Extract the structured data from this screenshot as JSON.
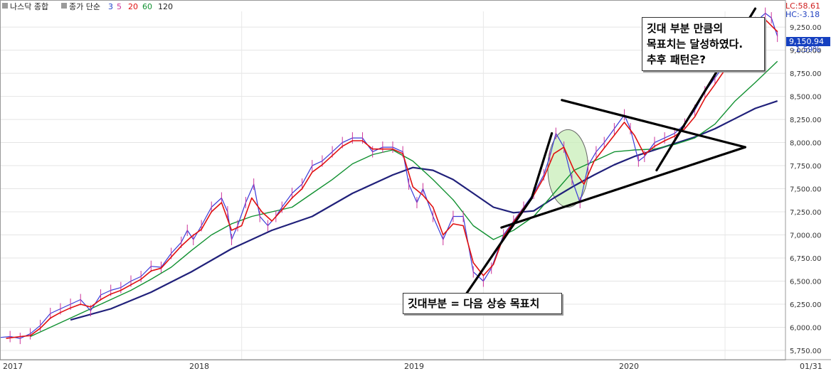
{
  "legend": {
    "title": "나스닥 종합",
    "series_label": "종가 단순",
    "periods": [
      "3",
      "5",
      "20",
      "60",
      "120"
    ]
  },
  "price_tag": "9,150.94",
  "info_lines": [
    "LC:58.61",
    "HC:-3.18",
    "-1.59%"
  ],
  "annotations": {
    "top": [
      "깃대 부분 만큼의",
      "목표치는 달성하였다.",
      "추후 패턴은?"
    ],
    "bottom": "깃대부분 = 다음 상승 목표치"
  },
  "chart_data": {
    "type": "line",
    "title": "나스닥 종합",
    "x_ticks": [
      "2017",
      "2018",
      "2019",
      "2020",
      "01/31"
    ],
    "y_ticks": [
      "9,250.00",
      "9,000.00",
      "8,750.00",
      "8,500.00",
      "8,250.00",
      "8,000.00",
      "7,750.00",
      "7,500.00",
      "7,250.00",
      "7,000.00",
      "6,750.00",
      "6,500.00",
      "6,250.00",
      "6,000.00",
      "5,750.00"
    ],
    "ylim": [
      5650,
      9420
    ],
    "xlim": [
      0,
      37
    ],
    "colors": {
      "price": "#3b3bd8",
      "price_alt": "#cc3399",
      "ma20": "#e01010",
      "ma60": "#109030",
      "ma120": "#20207a",
      "trend": "#000000",
      "highlight": "#c8eeb8",
      "price_tag_bg": "#1540c0",
      "info": "#d02020",
      "info2": "#2040c0"
    },
    "series": [
      {
        "name": "종가 단순 3",
        "values": [
          [
            0,
            5890
          ],
          [
            0.5,
            5900
          ],
          [
            1,
            5880
          ],
          [
            1.5,
            5930
          ],
          [
            2,
            6020
          ],
          [
            2.5,
            6150
          ],
          [
            3,
            6200
          ],
          [
            3.5,
            6250
          ],
          [
            4,
            6300
          ],
          [
            4.5,
            6180
          ],
          [
            5,
            6350
          ],
          [
            5.5,
            6400
          ],
          [
            6,
            6430
          ],
          [
            6.5,
            6500
          ],
          [
            7,
            6550
          ],
          [
            7.5,
            6660
          ],
          [
            8,
            6650
          ],
          [
            8.5,
            6800
          ],
          [
            9,
            6920
          ],
          [
            9.3,
            7050
          ],
          [
            9.6,
            6950
          ],
          [
            10,
            7100
          ],
          [
            10.5,
            7300
          ],
          [
            11,
            7400
          ],
          [
            11.3,
            7250
          ],
          [
            11.5,
            6950
          ],
          [
            11.8,
            7100
          ],
          [
            12.2,
            7350
          ],
          [
            12.6,
            7550
          ],
          [
            12.9,
            7200
          ],
          [
            13.3,
            7100
          ],
          [
            13.7,
            7200
          ],
          [
            14,
            7300
          ],
          [
            14.5,
            7450
          ],
          [
            15,
            7550
          ],
          [
            15.5,
            7750
          ],
          [
            16,
            7800
          ],
          [
            16.5,
            7900
          ],
          [
            17,
            8000
          ],
          [
            17.5,
            8050
          ],
          [
            18,
            8050
          ],
          [
            18.5,
            7900
          ],
          [
            19,
            7950
          ],
          [
            19.5,
            7950
          ],
          [
            20,
            7900
          ],
          [
            20.3,
            7550
          ],
          [
            20.7,
            7350
          ],
          [
            21,
            7500
          ],
          [
            21.5,
            7200
          ],
          [
            22,
            6950
          ],
          [
            22.5,
            7200
          ],
          [
            23,
            7200
          ],
          [
            23.5,
            6600
          ],
          [
            24,
            6500
          ],
          [
            24.4,
            6640
          ],
          [
            25,
            7000
          ],
          [
            25.5,
            7150
          ],
          [
            26,
            7300
          ],
          [
            26.5,
            7450
          ],
          [
            27,
            7650
          ],
          [
            27.3,
            7850
          ],
          [
            27.6,
            8100
          ],
          [
            28,
            7950
          ],
          [
            28.4,
            7600
          ],
          [
            28.8,
            7350
          ],
          [
            29.2,
            7750
          ],
          [
            29.6,
            7900
          ],
          [
            30,
            8000
          ],
          [
            30.5,
            8150
          ],
          [
            31,
            8300
          ],
          [
            31.3,
            8150
          ],
          [
            31.7,
            7800
          ],
          [
            32,
            7850
          ],
          [
            32.5,
            8000
          ],
          [
            33,
            8050
          ],
          [
            33.5,
            8100
          ],
          [
            34,
            8200
          ],
          [
            34.5,
            8350
          ],
          [
            35,
            8550
          ],
          [
            35.5,
            8700
          ],
          [
            36,
            8850
          ],
          [
            36.5,
            9000
          ],
          [
            37,
            9150
          ],
          [
            37.5,
            9300
          ],
          [
            38,
            9400
          ],
          [
            38.3,
            9350
          ],
          [
            38.6,
            9150
          ]
        ]
      },
      {
        "name": "20",
        "values": [
          [
            0.3,
            5880
          ],
          [
            1,
            5900
          ],
          [
            1.5,
            5910
          ],
          [
            2,
            5990
          ],
          [
            2.5,
            6100
          ],
          [
            3,
            6160
          ],
          [
            3.5,
            6210
          ],
          [
            4,
            6250
          ],
          [
            4.5,
            6220
          ],
          [
            5,
            6300
          ],
          [
            5.5,
            6360
          ],
          [
            6,
            6400
          ],
          [
            6.5,
            6460
          ],
          [
            7,
            6520
          ],
          [
            7.5,
            6610
          ],
          [
            8,
            6640
          ],
          [
            8.5,
            6760
          ],
          [
            9,
            6880
          ],
          [
            9.5,
            6980
          ],
          [
            10,
            7060
          ],
          [
            10.5,
            7250
          ],
          [
            11,
            7350
          ],
          [
            11.5,
            7050
          ],
          [
            12,
            7100
          ],
          [
            12.5,
            7400
          ],
          [
            13,
            7250
          ],
          [
            13.5,
            7150
          ],
          [
            14,
            7270
          ],
          [
            14.5,
            7400
          ],
          [
            15,
            7500
          ],
          [
            15.5,
            7680
          ],
          [
            16,
            7760
          ],
          [
            16.5,
            7860
          ],
          [
            17,
            7960
          ],
          [
            17.5,
            8020
          ],
          [
            18,
            8020
          ],
          [
            18.5,
            7930
          ],
          [
            19,
            7930
          ],
          [
            19.5,
            7930
          ],
          [
            20,
            7880
          ],
          [
            20.5,
            7520
          ],
          [
            21,
            7430
          ],
          [
            21.5,
            7300
          ],
          [
            22,
            7000
          ],
          [
            22.5,
            7120
          ],
          [
            23,
            7100
          ],
          [
            23.5,
            6700
          ],
          [
            24,
            6560
          ],
          [
            24.5,
            6680
          ],
          [
            25,
            6980
          ],
          [
            25.5,
            7140
          ],
          [
            26,
            7290
          ],
          [
            26.5,
            7430
          ],
          [
            27,
            7620
          ],
          [
            27.5,
            7880
          ],
          [
            28,
            7950
          ],
          [
            28.5,
            7700
          ],
          [
            29,
            7550
          ],
          [
            29.5,
            7800
          ],
          [
            30,
            7940
          ],
          [
            30.5,
            8080
          ],
          [
            31,
            8220
          ],
          [
            31.5,
            8080
          ],
          [
            32,
            7870
          ],
          [
            32.5,
            7960
          ],
          [
            33,
            8020
          ],
          [
            33.5,
            8070
          ],
          [
            34,
            8150
          ],
          [
            34.5,
            8280
          ],
          [
            35,
            8480
          ],
          [
            35.5,
            8630
          ],
          [
            36,
            8790
          ],
          [
            36.5,
            8940
          ],
          [
            37,
            9080
          ],
          [
            37.5,
            9220
          ],
          [
            38,
            9330
          ],
          [
            38.6,
            9200
          ]
        ]
      },
      {
        "name": "60",
        "values": [
          [
            1.5,
            5900
          ],
          [
            2.5,
            6000
          ],
          [
            3.5,
            6100
          ],
          [
            4.5,
            6200
          ],
          [
            5.5,
            6300
          ],
          [
            6.5,
            6400
          ],
          [
            7.5,
            6520
          ],
          [
            8.5,
            6650
          ],
          [
            9.5,
            6830
          ],
          [
            10.5,
            7000
          ],
          [
            11.5,
            7120
          ],
          [
            12.5,
            7200
          ],
          [
            13.5,
            7250
          ],
          [
            14.5,
            7300
          ],
          [
            15.5,
            7450
          ],
          [
            16.5,
            7600
          ],
          [
            17.5,
            7770
          ],
          [
            18.5,
            7870
          ],
          [
            19.5,
            7920
          ],
          [
            20.5,
            7800
          ],
          [
            21.5,
            7600
          ],
          [
            22.5,
            7380
          ],
          [
            23.5,
            7100
          ],
          [
            24.5,
            6950
          ],
          [
            25.5,
            7050
          ],
          [
            26.5,
            7200
          ],
          [
            27.5,
            7450
          ],
          [
            28.5,
            7700
          ],
          [
            29.5,
            7800
          ],
          [
            30.5,
            7900
          ],
          [
            31.5,
            7920
          ],
          [
            32.5,
            7930
          ],
          [
            33.5,
            7980
          ],
          [
            34.5,
            8050
          ],
          [
            35.5,
            8200
          ],
          [
            36.5,
            8450
          ],
          [
            37.5,
            8650
          ],
          [
            38.6,
            8880
          ]
        ]
      },
      {
        "name": "120",
        "values": [
          [
            3.5,
            6080
          ],
          [
            5.5,
            6200
          ],
          [
            7.5,
            6380
          ],
          [
            9.5,
            6600
          ],
          [
            11.5,
            6850
          ],
          [
            13.5,
            7050
          ],
          [
            15.5,
            7200
          ],
          [
            17.5,
            7450
          ],
          [
            19.5,
            7650
          ],
          [
            20.5,
            7730
          ],
          [
            21.5,
            7700
          ],
          [
            22.5,
            7600
          ],
          [
            23.5,
            7450
          ],
          [
            24.5,
            7300
          ],
          [
            25.5,
            7240
          ],
          [
            26.5,
            7260
          ],
          [
            27.5,
            7400
          ],
          [
            28.5,
            7530
          ],
          [
            29.5,
            7650
          ],
          [
            30.5,
            7760
          ],
          [
            31.5,
            7850
          ],
          [
            32.5,
            7920
          ],
          [
            33.5,
            7990
          ],
          [
            34.5,
            8060
          ],
          [
            35.5,
            8150
          ],
          [
            36.5,
            8260
          ],
          [
            37.5,
            8370
          ],
          [
            38.6,
            8450
          ]
        ]
      }
    ],
    "trend_lines": [
      {
        "name": "flagpole-1",
        "points": [
          [
            22.8,
            6250
          ],
          [
            26.4,
            7400
          ]
        ]
      },
      {
        "name": "flagpole-2",
        "points": [
          [
            26.4,
            7400
          ],
          [
            27.4,
            8100
          ]
        ]
      },
      {
        "name": "pennant-top",
        "points": [
          [
            27.9,
            8460
          ],
          [
            37,
            7950
          ]
        ]
      },
      {
        "name": "pennant-bottom",
        "points": [
          [
            24.9,
            7080
          ],
          [
            37,
            7950
          ]
        ]
      },
      {
        "name": "flagpole-3",
        "points": [
          [
            32.6,
            7700
          ],
          [
            37.5,
            9450
          ]
        ]
      }
    ],
    "highlight_ellipse": {
      "cx": 28.2,
      "cy": 7720,
      "rx": 1.0,
      "ry": 420
    }
  }
}
